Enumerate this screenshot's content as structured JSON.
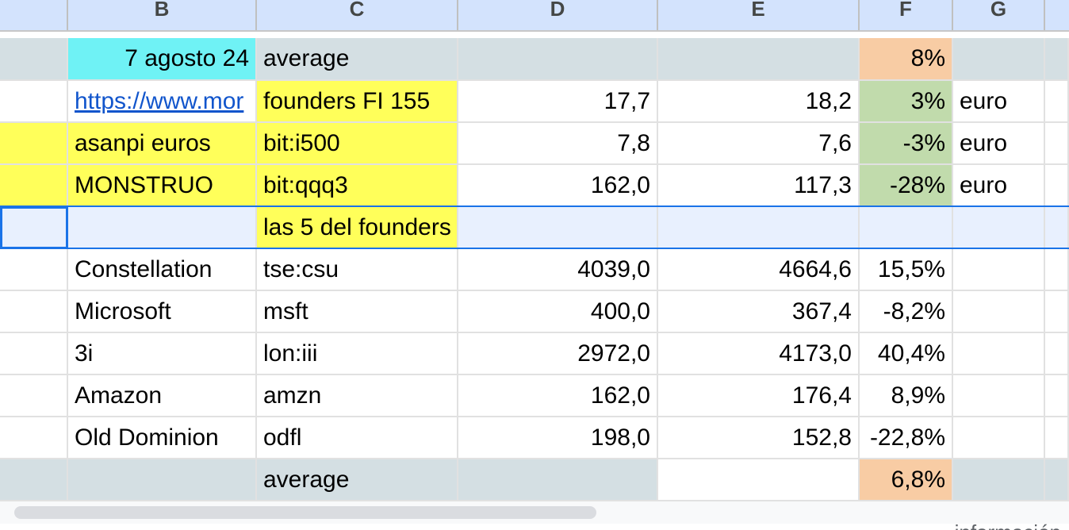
{
  "columns": [
    "B",
    "C",
    "D",
    "E",
    "F",
    "G"
  ],
  "colors": {
    "cyan": "#6ff2f5",
    "yellow": "#ffff5a",
    "orange": "#f8cca4",
    "green": "#c1dbac",
    "gray": "#d4dfe3",
    "selection": "#1a73e8"
  },
  "rows": [
    {
      "a": "",
      "b": "7 agosto 24",
      "c": "average",
      "d": "",
      "e": "",
      "f": "8%",
      "g": ""
    },
    {
      "a": "",
      "b": "https://www.mor",
      "c": "founders  FI 155",
      "d": "17,7",
      "e": "18,2",
      "f": "3%",
      "g": "euro"
    },
    {
      "a": "",
      "b": "asanpi euros",
      "c": "bit:i500",
      "d": "7,8",
      "e": "7,6",
      "f": "-3%",
      "g": "euro"
    },
    {
      "a": "",
      "b": "MONSTRUO",
      "c": "bit:qqq3",
      "d": "162,0",
      "e": "117,3",
      "f": "-28%",
      "g": "euro"
    },
    {
      "a": "",
      "b": "",
      "c": "las 5 del founders",
      "d": "",
      "e": "",
      "f": "",
      "g": ""
    },
    {
      "a": "",
      "b": "Constellation",
      "c": "tse:csu",
      "d": "4039,0",
      "e": "4664,6",
      "f": "15,5%",
      "g": ""
    },
    {
      "a": "",
      "b": "Microsoft",
      "c": "msft",
      "d": "400,0",
      "e": "367,4",
      "f": "-8,2%",
      "g": ""
    },
    {
      "a": "",
      "b": "3i",
      "c": "lon:iii",
      "d": "2972,0",
      "e": "4173,0",
      "f": "40,4%",
      "g": ""
    },
    {
      "a": "",
      "b": "Amazon",
      "c": "amzn",
      "d": "162,0",
      "e": "176,4",
      "f": "8,9%",
      "g": ""
    },
    {
      "a": "",
      "b": "Old Dominion",
      "c": "odfl",
      "d": "198,0",
      "e": "152,8",
      "f": "-22,8%",
      "g": ""
    },
    {
      "a": "",
      "b": "",
      "c": "average",
      "d": "",
      "e": "",
      "f": "6,8%",
      "g": ""
    }
  ],
  "footer_text": "... información"
}
